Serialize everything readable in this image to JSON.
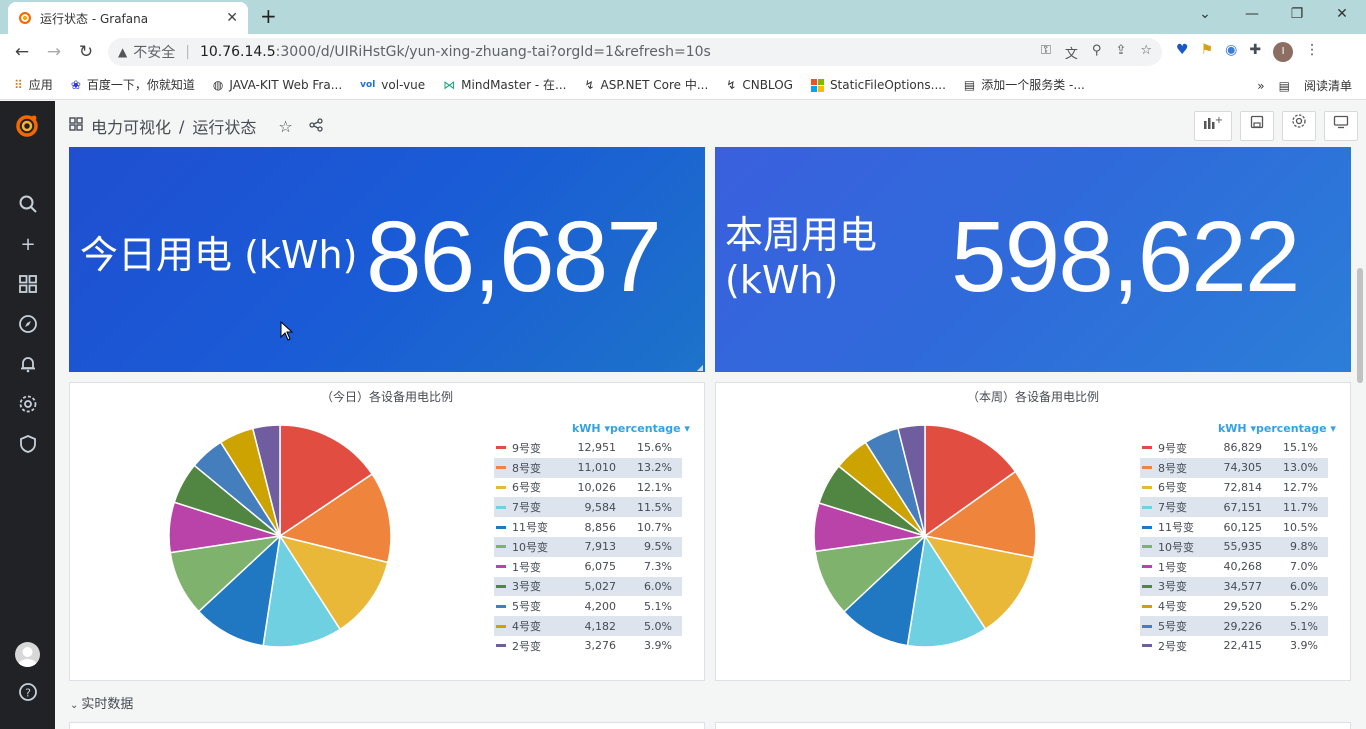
{
  "browser": {
    "tab_title": "运行状态 - Grafana",
    "insecure_label": "不安全",
    "url_host": "10.76.14.5",
    "url_path": ":3000/d/UIRiHstGk/yun-xing-zhuang-tai?orgId=1&refresh=10s",
    "avatar_letter": "I",
    "bookmarks": [
      {
        "icon": "apps-icon",
        "label": "应用"
      },
      {
        "icon": "paw-icon",
        "label": "百度一下，你就知道"
      },
      {
        "icon": "globe-icon",
        "label": "JAVA-KIT Web Fra..."
      },
      {
        "icon": "vol-icon",
        "label": "vol-vue"
      },
      {
        "icon": "mindmaster-icon",
        "label": "MindMaster - 在..."
      },
      {
        "icon": "asp-icon",
        "label": "ASP.NET Core 中..."
      },
      {
        "icon": "cnblog-icon",
        "label": "CNBLOG"
      },
      {
        "icon": "windows-icon",
        "label": "StaticFileOptions...."
      },
      {
        "icon": "book-icon",
        "label": "添加一个服务类 -..."
      }
    ],
    "reading_list": "阅读清单",
    "more_bookmarks": "»"
  },
  "dashboard": {
    "folder": "电力可视化",
    "separator": "/",
    "title": "运行状态",
    "row_title": "实时数据"
  },
  "stats": {
    "today": {
      "label": "今日用电 (kWh)",
      "value": "86,687"
    },
    "week": {
      "label_line1": "本周用电",
      "label_line2": "(kWh)",
      "value": "598,622"
    }
  },
  "legend_headers": {
    "kwh": "kWH ▾",
    "percentage": "percentage ▾"
  },
  "colors": {
    "9号变": "#e24d42",
    "8号变": "#ef843c",
    "6号变": "#eab839",
    "7号变": "#6ed0e0",
    "11号变": "#1f78c1",
    "10号变": "#7eb26d",
    "1号变": "#ba43a9",
    "3号变": "#508642",
    "5号变": "#447ebc",
    "4号变": "#cca300",
    "2号变": "#705da0"
  },
  "pie_today": {
    "title": "（今日）各设备用电比例",
    "items": [
      {
        "name": "9号变",
        "kwh": "12,951",
        "pct": "15.6%",
        "value": 12951
      },
      {
        "name": "8号变",
        "kwh": "11,010",
        "pct": "13.2%",
        "value": 11010
      },
      {
        "name": "6号变",
        "kwh": "10,026",
        "pct": "12.1%",
        "value": 10026
      },
      {
        "name": "7号变",
        "kwh": "9,584",
        "pct": "11.5%",
        "value": 9584
      },
      {
        "name": "11号变",
        "kwh": "8,856",
        "pct": "10.7%",
        "value": 8856
      },
      {
        "name": "10号变",
        "kwh": "7,913",
        "pct": "9.5%",
        "value": 7913
      },
      {
        "name": "1号变",
        "kwh": "6,075",
        "pct": "7.3%",
        "value": 6075
      },
      {
        "name": "3号变",
        "kwh": "5,027",
        "pct": "6.0%",
        "value": 5027
      },
      {
        "name": "5号变",
        "kwh": "4,200",
        "pct": "5.1%",
        "value": 4200
      },
      {
        "name": "4号变",
        "kwh": "4,182",
        "pct": "5.0%",
        "value": 4182
      },
      {
        "name": "2号变",
        "kwh": "3,276",
        "pct": "3.9%",
        "value": 3276
      }
    ]
  },
  "pie_week": {
    "title": "（本周）各设备用电比例",
    "items": [
      {
        "name": "9号变",
        "kwh": "86,829",
        "pct": "15.1%",
        "value": 86829
      },
      {
        "name": "8号变",
        "kwh": "74,305",
        "pct": "13.0%",
        "value": 74305
      },
      {
        "name": "6号变",
        "kwh": "72,814",
        "pct": "12.7%",
        "value": 72814
      },
      {
        "name": "7号变",
        "kwh": "67,151",
        "pct": "11.7%",
        "value": 67151
      },
      {
        "name": "11号变",
        "kwh": "60,125",
        "pct": "10.5%",
        "value": 60125
      },
      {
        "name": "10号变",
        "kwh": "55,935",
        "pct": "9.8%",
        "value": 55935
      },
      {
        "name": "1号变",
        "kwh": "40,268",
        "pct": "7.0%",
        "value": 40268
      },
      {
        "name": "3号变",
        "kwh": "34,577",
        "pct": "6.0%",
        "value": 34577
      },
      {
        "name": "4号变",
        "kwh": "29,520",
        "pct": "5.2%",
        "value": 29520
      },
      {
        "name": "5号变",
        "kwh": "29,226",
        "pct": "5.1%",
        "value": 29226
      },
      {
        "name": "2号变",
        "kwh": "22,415",
        "pct": "3.9%",
        "value": 22415
      }
    ]
  }
}
